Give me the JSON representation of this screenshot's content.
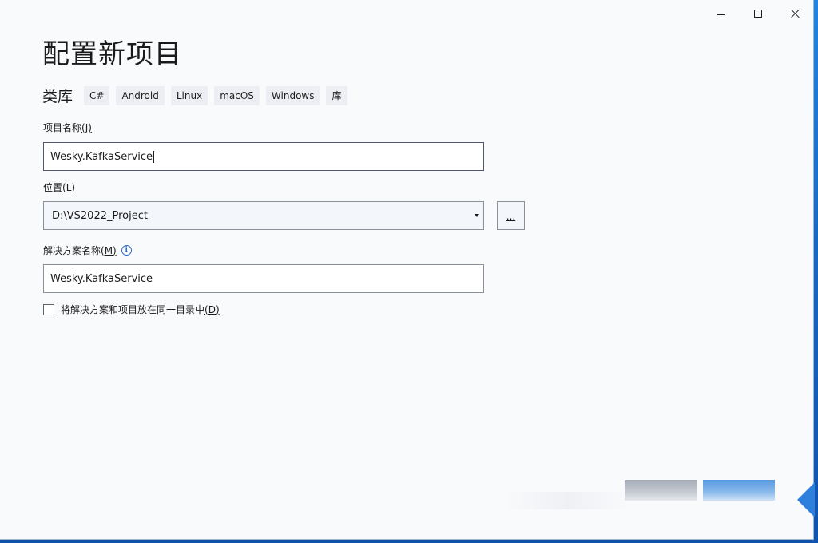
{
  "window": {
    "controls": {
      "minimize": "minimize",
      "maximize": "maximize",
      "close": "close"
    }
  },
  "page": {
    "title": "配置新项目",
    "subtitle": "类库",
    "tags": [
      "C#",
      "Android",
      "Linux",
      "macOS",
      "Windows",
      "库"
    ]
  },
  "project_name": {
    "label": "项目名称",
    "hotkey": "(J)",
    "value": "Wesky.KafkaService"
  },
  "location": {
    "label": "位置",
    "hotkey": "(L)",
    "value": "D:\\VS2022_Project",
    "browse_label": "..."
  },
  "solution_name": {
    "label": "解决方案名称",
    "hotkey": "(M)",
    "info_icon": "info-icon",
    "value": "Wesky.KafkaService"
  },
  "same_dir_checkbox": {
    "label": "将解决方案和项目放在同一目录中",
    "hotkey": "(D)",
    "checked": false
  },
  "colors": {
    "background": "#f9fafc",
    "accent": "#2a6bd1",
    "desktop": "#1668c7"
  }
}
